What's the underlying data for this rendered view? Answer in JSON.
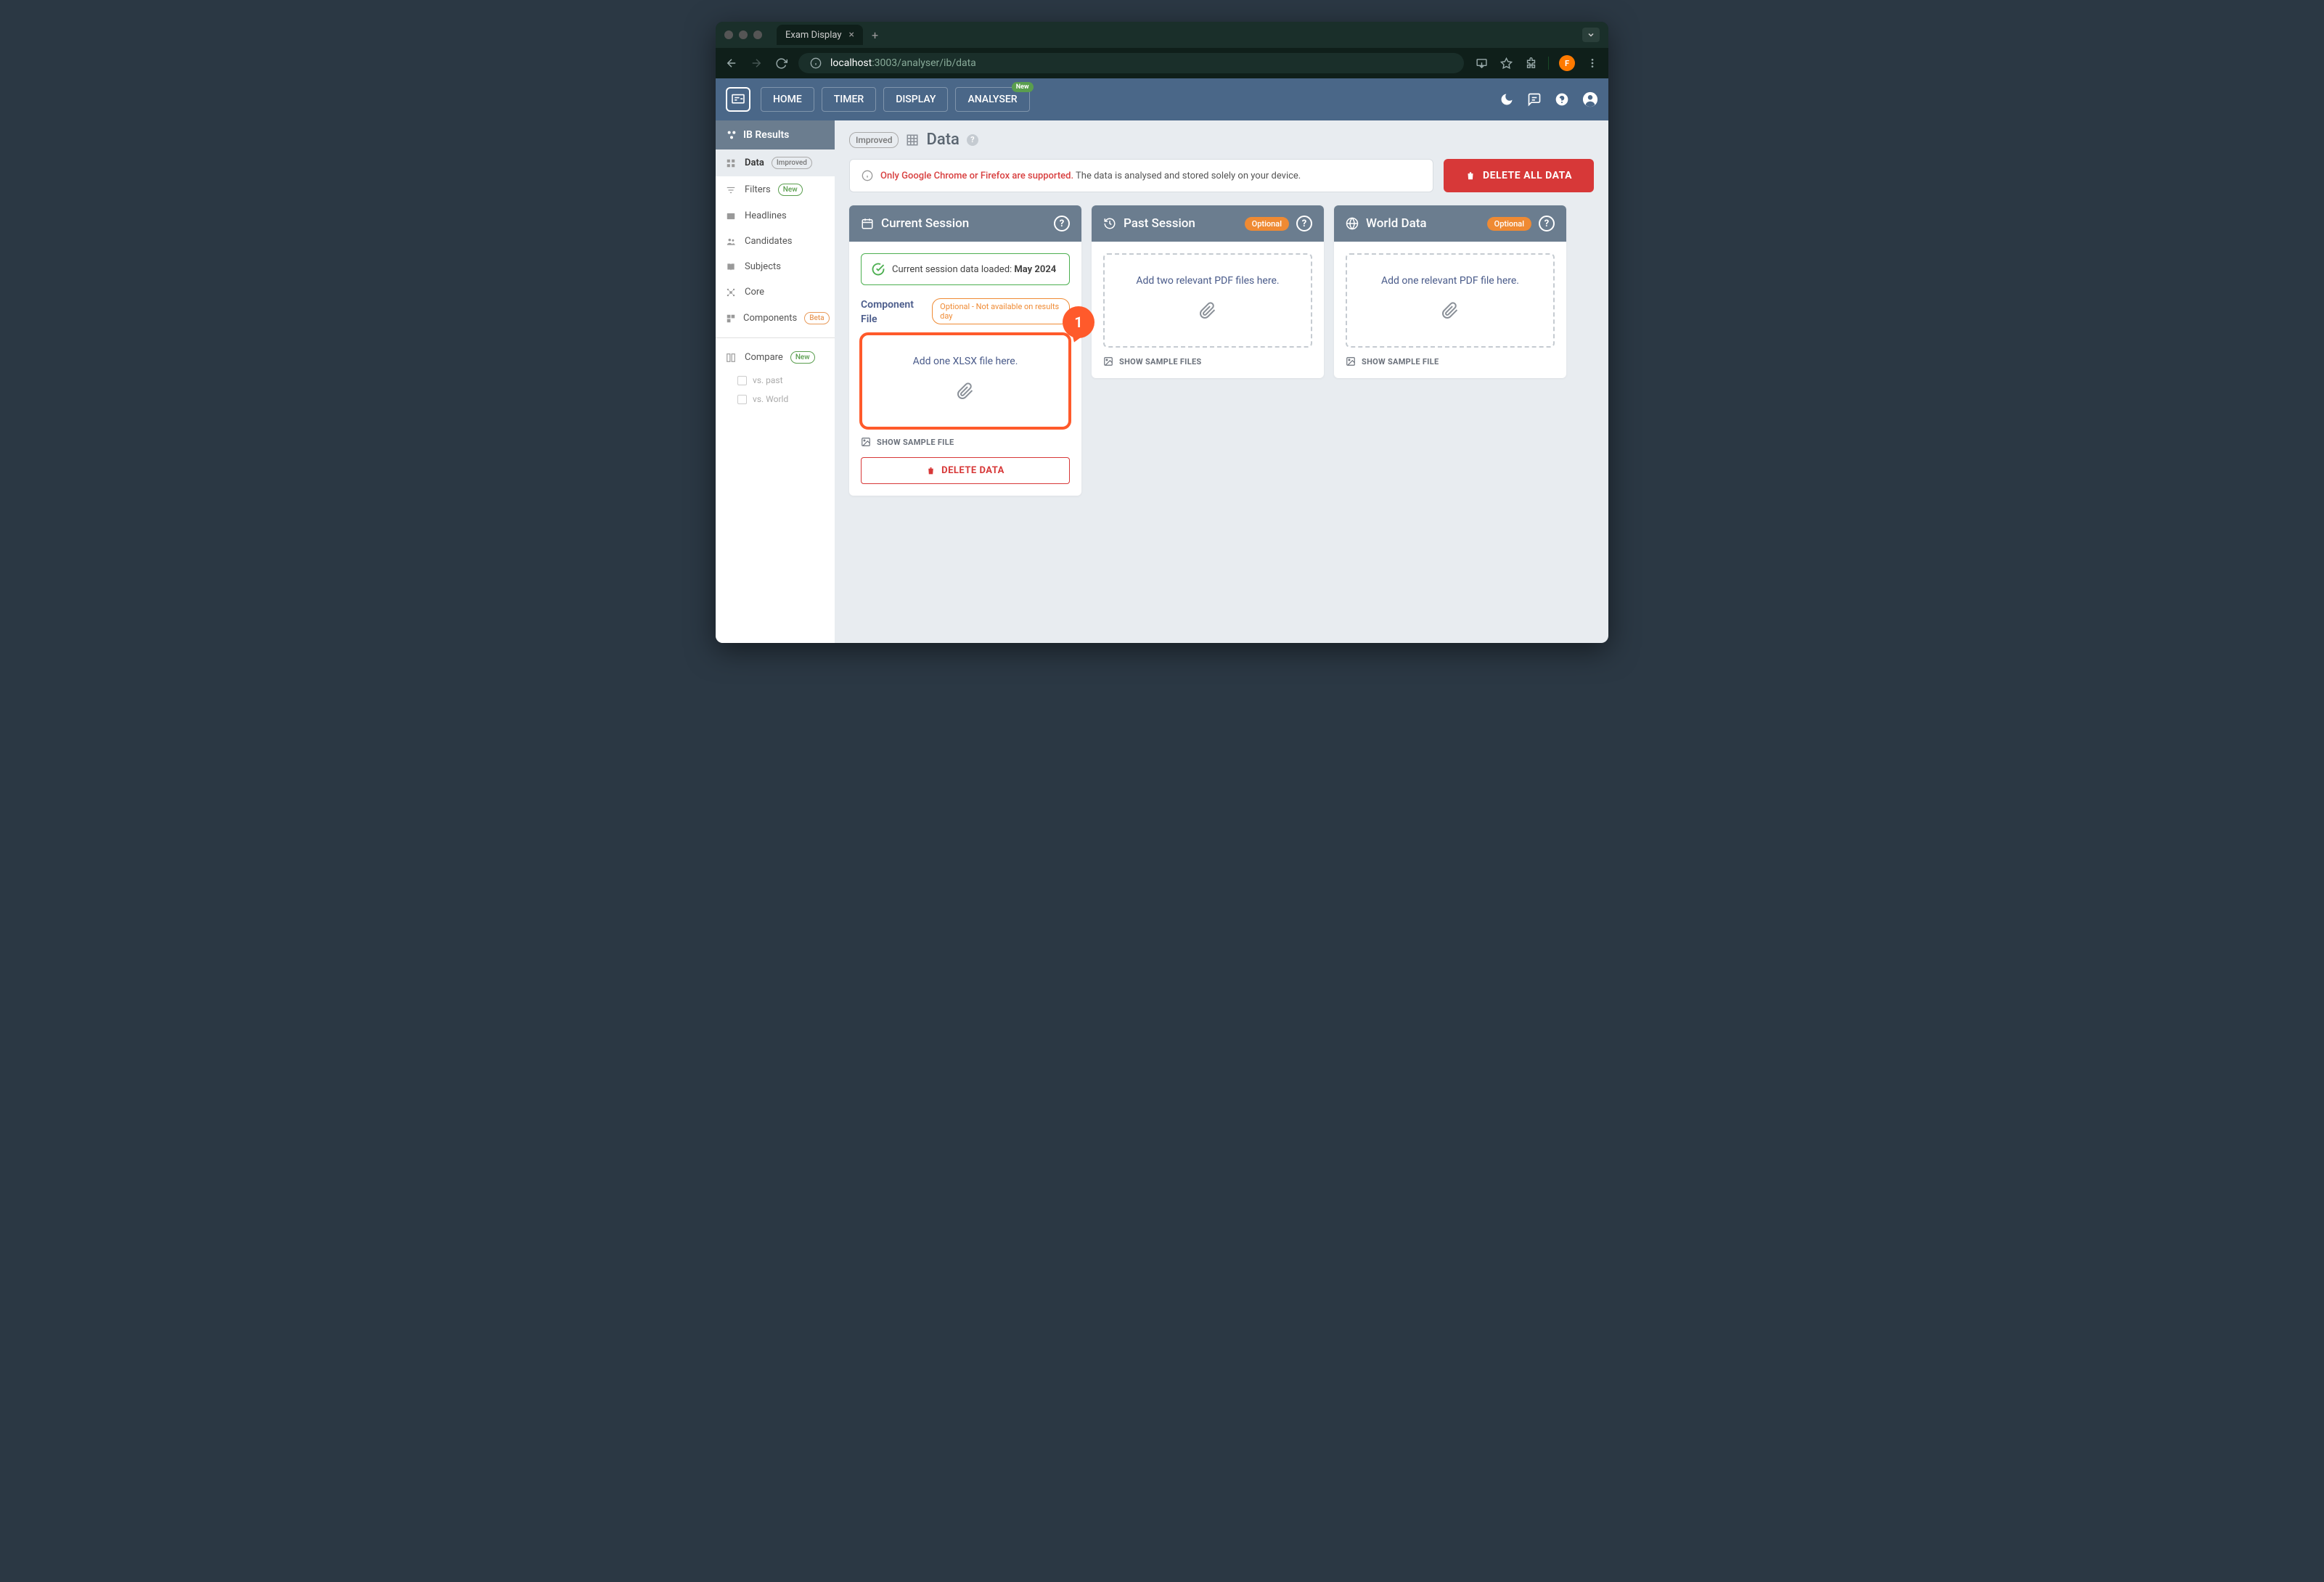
{
  "browser": {
    "tab_title": "Exam Display",
    "url_host": "localhost",
    "url_port_path": ":3003/analyser/ib/data",
    "avatar_letter": "F"
  },
  "header": {
    "nav": [
      "HOME",
      "TIMER",
      "DISPLAY",
      "ANALYSER"
    ],
    "new_badge": "New"
  },
  "sidebar": {
    "title": "IB Results",
    "items": [
      {
        "label": "Data",
        "badge": "Improved",
        "badge_type": "improved",
        "active": true,
        "icon": "data"
      },
      {
        "label": "Filters",
        "badge": "New",
        "badge_type": "new",
        "icon": "filter"
      },
      {
        "label": "Headlines",
        "icon": "headlines"
      },
      {
        "label": "Candidates",
        "icon": "people"
      },
      {
        "label": "Subjects",
        "icon": "book"
      },
      {
        "label": "Core",
        "icon": "core"
      },
      {
        "label": "Components",
        "badge": "Beta",
        "badge_type": "beta",
        "icon": "components"
      }
    ],
    "compare": {
      "label": "Compare",
      "badge": "New"
    },
    "sub": [
      "vs. past",
      "vs. World"
    ]
  },
  "page": {
    "improved_pill": "Improved",
    "title": "Data",
    "warning_bold": "Only Google Chrome or Firefox are supported.",
    "warning_rest": " The data is analysed and stored solely on your device.",
    "delete_all": "DELETE ALL DATA"
  },
  "cards": {
    "current": {
      "title": "Current Session",
      "success_prefix": "Current session data loaded: ",
      "success_bold": "May 2024",
      "section_label": "Component File",
      "optional_pill": "Optional - Not available on results day",
      "dropzone": "Add one XLSX file here.",
      "sample": "SHOW SAMPLE FILE",
      "delete": "DELETE DATA",
      "callout": "1"
    },
    "past": {
      "title": "Past Session",
      "optional": "Optional",
      "dropzone": "Add two relevant PDF files here.",
      "sample": "SHOW SAMPLE FILES"
    },
    "world": {
      "title": "World Data",
      "optional": "Optional",
      "dropzone": "Add one relevant PDF file here.",
      "sample": "SHOW SAMPLE FILE"
    }
  }
}
